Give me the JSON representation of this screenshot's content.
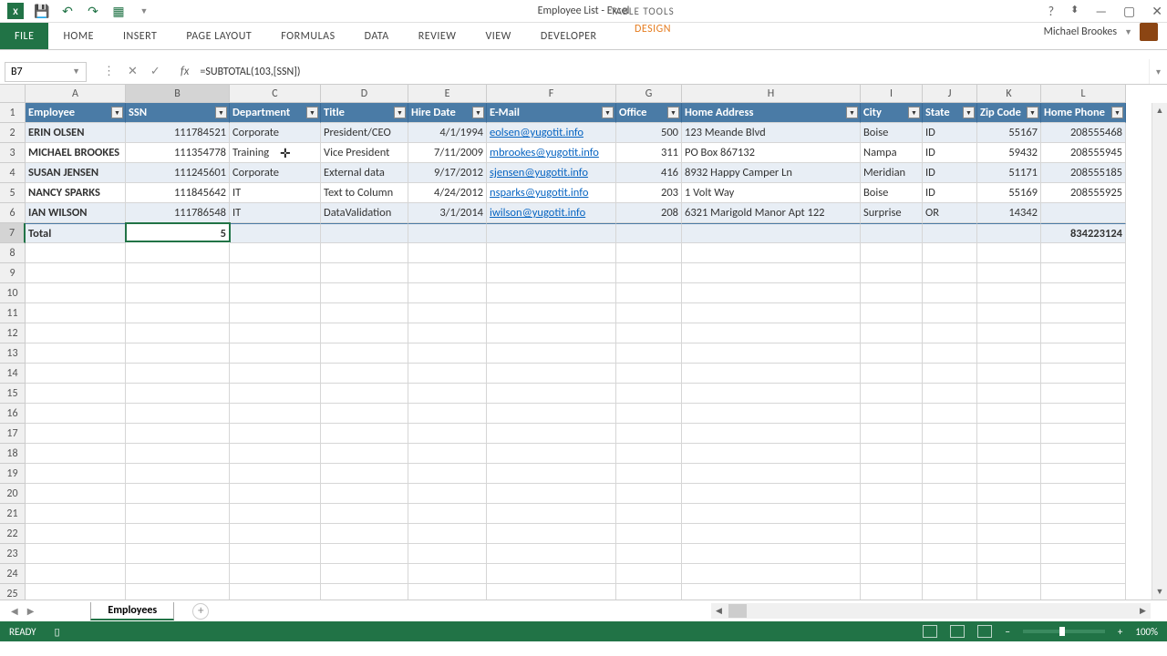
{
  "app": {
    "title": "Employee List - Excel",
    "tableTools": "TABLE TOOLS"
  },
  "qat": {
    "save": "💾",
    "undo": "↶",
    "redo": "↷",
    "custom": "▦"
  },
  "tabs": [
    "FILE",
    "HOME",
    "INSERT",
    "PAGE LAYOUT",
    "FORMULAS",
    "DATA",
    "REVIEW",
    "VIEW",
    "DEVELOPER"
  ],
  "designTab": "DESIGN",
  "user": "Michael Brookes",
  "nameBox": "B7",
  "formula": "=SUBTOTAL(103,[SSN])",
  "columnLetters": [
    "A",
    "B",
    "C",
    "D",
    "E",
    "F",
    "G",
    "H",
    "I",
    "J",
    "K",
    "L"
  ],
  "headers": [
    "Employee",
    "SSN",
    "Department",
    "Title",
    "Hire Date",
    "E-Mail",
    "Office",
    "Home Address",
    "City",
    "State",
    "Zip Code",
    "Home Phone"
  ],
  "rows": [
    {
      "employee": "ERIN OLSEN",
      "ssn": "111784521",
      "dept": "Corporate",
      "title": "President/CEO",
      "hire": "4/1/1994",
      "email": "eolsen@yugotit.info",
      "office": "500",
      "addr": "123 Meande Blvd",
      "city": "Boise",
      "state": "ID",
      "zip": "55167",
      "phone": "208555468"
    },
    {
      "employee": "MICHAEL BROOKES",
      "ssn": "111354778",
      "dept": "Training",
      "title": "Vice President",
      "hire": "7/11/2009",
      "email": "mbrookes@yugotit.info",
      "office": "311",
      "addr": "PO Box 867132",
      "city": "Nampa",
      "state": "ID",
      "zip": "59432",
      "phone": "208555945"
    },
    {
      "employee": "SUSAN JENSEN",
      "ssn": "111245601",
      "dept": "Corporate",
      "title": "External data",
      "hire": "9/17/2012",
      "email": "sjensen@yugotit.info",
      "office": "416",
      "addr": "8932 Happy Camper Ln",
      "city": "Meridian",
      "state": "ID",
      "zip": "51171",
      "phone": "208555185"
    },
    {
      "employee": "NANCY SPARKS",
      "ssn": "111845642",
      "dept": "IT",
      "title": "Text to Column",
      "hire": "4/24/2012",
      "email": "nsparks@yugotit.info",
      "office": "203",
      "addr": "1 Volt Way",
      "city": "Boise",
      "state": "ID",
      "zip": "55169",
      "phone": "208555925"
    },
    {
      "employee": "IAN WILSON",
      "ssn": "111786548",
      "dept": "IT",
      "title": "DataValidation",
      "hire": "3/1/2014",
      "email": "iwilson@yugotit.info",
      "office": "208",
      "addr": "6321 Marigold Manor Apt 122",
      "city": "Surprise",
      "state": "OR",
      "zip": "14342",
      "phone": ""
    }
  ],
  "totalRow": {
    "label": "Total",
    "count": "5",
    "phoneTotal": "834223124"
  },
  "rowNumbers": [
    "1",
    "2",
    "3",
    "4",
    "5",
    "6",
    "7",
    "8",
    "9",
    "10",
    "11",
    "12",
    "13",
    "14",
    "15",
    "16",
    "17",
    "18",
    "19",
    "20",
    "21",
    "22",
    "23",
    "24",
    "25"
  ],
  "sheet": "Employees",
  "status": "READY",
  "zoom": "100%"
}
